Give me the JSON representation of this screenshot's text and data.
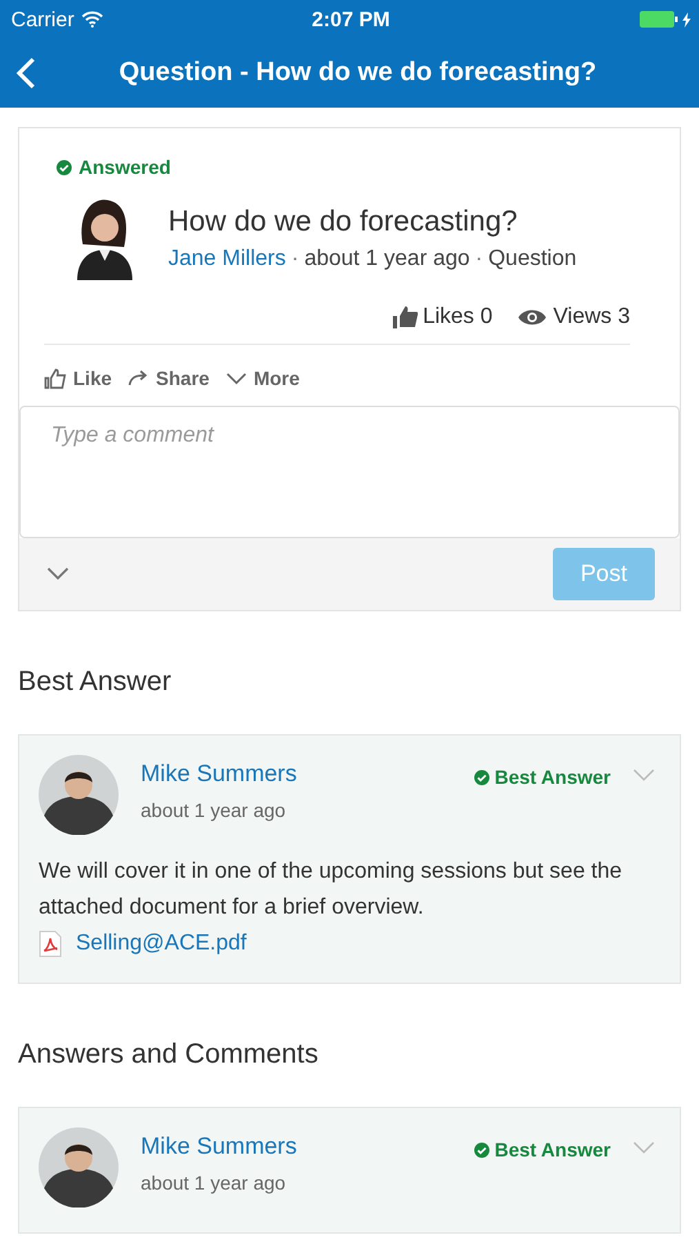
{
  "status_bar": {
    "carrier": "Carrier",
    "time": "2:07 PM"
  },
  "nav": {
    "title": "Question - How do we do forecasting?"
  },
  "question": {
    "status": "Answered",
    "title": "How do we do forecasting?",
    "author": "Jane Millers",
    "meta": [
      {
        "separator": "·",
        "text": "about 1 year ago"
      },
      {
        "separator": "·",
        "text": "Question"
      }
    ],
    "stats": [
      {
        "kind": "likes",
        "label": "Likes 0"
      },
      {
        "kind": "views",
        "label": "Views 3"
      }
    ],
    "actions": [
      {
        "kind": "like",
        "label": "Like"
      },
      {
        "kind": "share",
        "label": "Share"
      },
      {
        "kind": "more",
        "label": "More"
      }
    ]
  },
  "composer": {
    "placeholder": "Type a comment",
    "post": {
      "label": "Post",
      "disabled": true
    }
  },
  "sections": [
    {
      "heading": "Best Answer",
      "answers": [
        {
          "author": "Mike Summers",
          "time": "about 1 year ago",
          "badge": "Best Answer",
          "body": "We will cover it in one of the upcoming sessions but see the attached document for a brief overview.",
          "attachment": "Selling@ACE.pdf"
        }
      ]
    },
    {
      "heading": "Answers and Comments",
      "answers": [
        {
          "author": "Mike Summers",
          "time": "about 1 year ago",
          "badge": "Best Answer"
        }
      ]
    }
  ]
}
